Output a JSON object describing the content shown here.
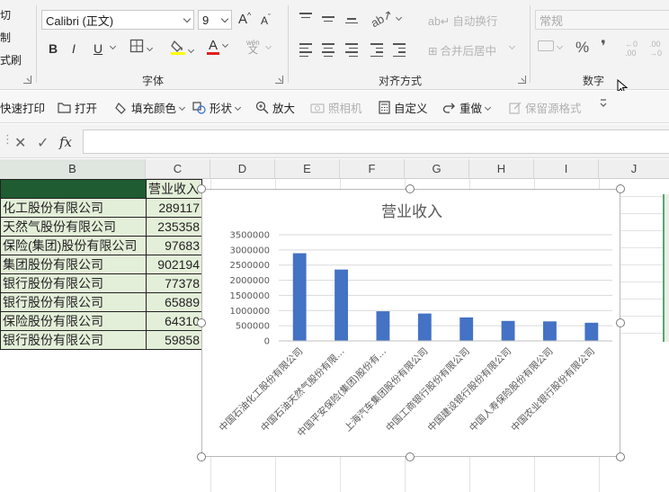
{
  "ribbon": {
    "clipboard": {
      "cut": "剪切",
      "copy": "复制",
      "format_painter": "格式刷"
    },
    "font": {
      "group_label": "字体",
      "font_name": "Calibri (正文)",
      "font_size": "9",
      "grow": "A",
      "shrink": "A",
      "bold": "B",
      "italic": "I",
      "underline": "U",
      "font_color_glyph": "A",
      "wen": "wén",
      "wen_char": "文"
    },
    "alignment": {
      "group_label": "对齐方式",
      "wrap_text": "自动换行",
      "merge_center": "合并后居中"
    },
    "number": {
      "group_label": "数字",
      "format": "常规",
      "percent": "%",
      "comma": "❜",
      "inc_top": "←0",
      "inc_bottom": ".00",
      "dec_top": ".00",
      "dec_bottom": "→0"
    }
  },
  "qat": {
    "items": [
      {
        "label": "快速打印",
        "icon": ""
      },
      {
        "label": "打开",
        "icon": "folder-icon"
      },
      {
        "label": "填充颜色",
        "icon": "fill-icon"
      },
      {
        "label": "形状",
        "icon": "shapes-icon"
      },
      {
        "label": "放大",
        "icon": "zoom-icon"
      },
      {
        "label": "照相机",
        "icon": "camera-icon"
      },
      {
        "label": "自定义",
        "icon": "calculator-icon"
      },
      {
        "label": "重做",
        "icon": "redo-icon"
      },
      {
        "label": "保留源格式",
        "icon": "paste-icon"
      }
    ]
  },
  "formula_bar": {
    "fx": "fx",
    "value": ""
  },
  "grid": {
    "columns": [
      "B",
      "C",
      "D",
      "E",
      "F",
      "G",
      "H",
      "I",
      "J"
    ],
    "rows": [
      {
        "b": "",
        "c": "营业收入"
      },
      {
        "b": "化工股份有限公司",
        "c": "289117"
      },
      {
        "b": "天然气股份有限公司",
        "c": "235358"
      },
      {
        "b": "保险(集团)股份有限公司",
        "c": "97683"
      },
      {
        "b": "集团股份有限公司",
        "c": "902194"
      },
      {
        "b": "银行股份有限公司",
        "c": "77378"
      },
      {
        "b": "银行股份有限公司",
        "c": "65889"
      },
      {
        "b": "保险股份有限公司",
        "c": "64310"
      },
      {
        "b": "银行股份有限公司",
        "c": "59858"
      }
    ]
  },
  "chart_data": {
    "type": "bar",
    "title": "营业收入",
    "categories": [
      "中国石油化工股份有限公司",
      "中国石油天然气股份有限…",
      "中国平安保险(集团)股份有…",
      "上海汽车集团股份有限公司",
      "中国工商银行股份有限公司",
      "中国建设银行股份有限公司",
      "中国人寿保险股份有限公司",
      "中国农业银行股份有限公司"
    ],
    "values": [
      2891170,
      2353580,
      976830,
      902194,
      773780,
      658890,
      643100,
      598580
    ],
    "yticks": [
      "0",
      "500000",
      "1000000",
      "1500000",
      "2000000",
      "2500000",
      "3000000",
      "3500000"
    ],
    "ylim": [
      0,
      3500000
    ],
    "bar_color": "#4472c4",
    "grid": true,
    "legend": "none"
  }
}
